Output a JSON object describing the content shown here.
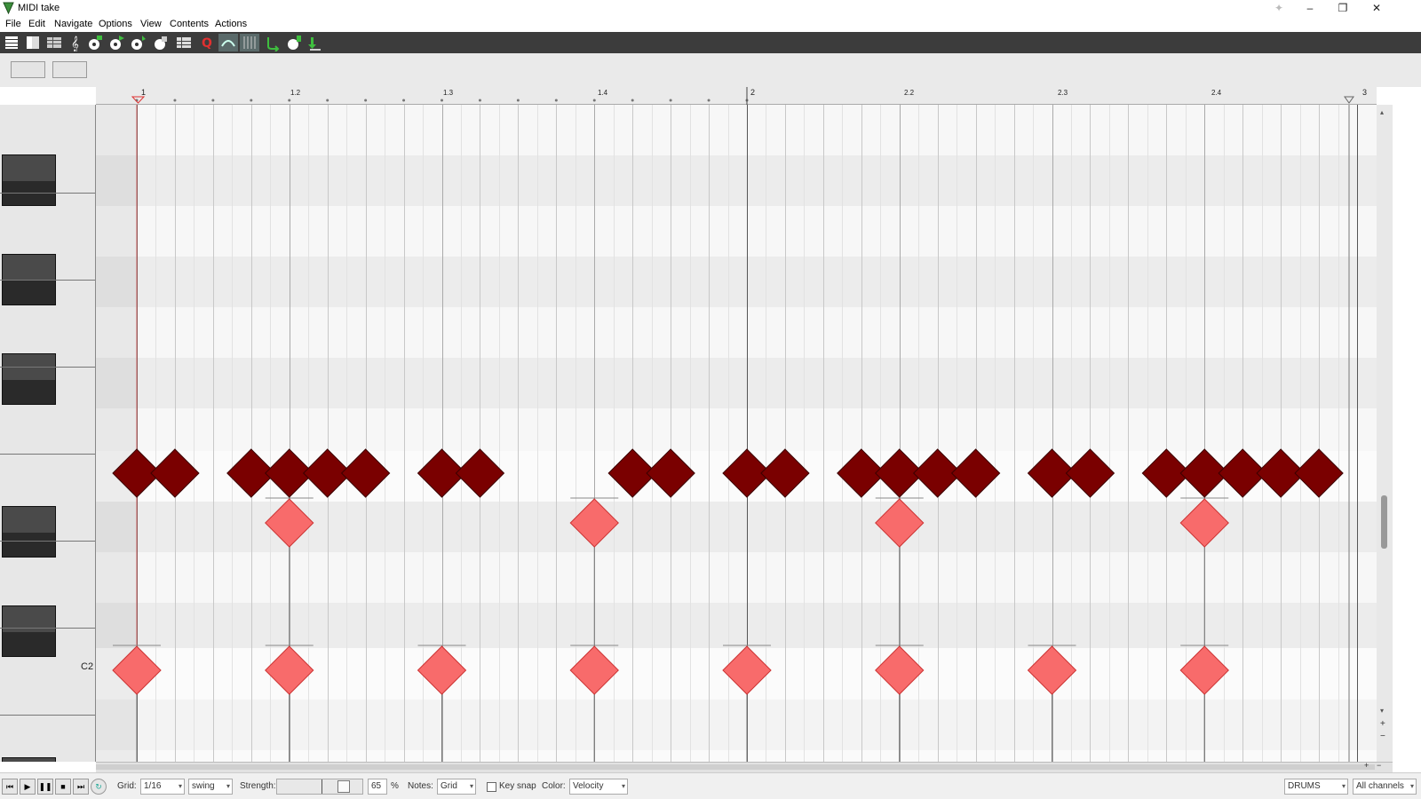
{
  "window": {
    "title": "MIDI take",
    "controls": {
      "minimize": "–",
      "restore": "❐",
      "close": "✕"
    },
    "pin_icon": "pin-icon"
  },
  "menu": [
    "File",
    "Edit",
    "Navigate",
    "Options",
    "View",
    "Contents",
    "Actions"
  ],
  "toolbar": {
    "buttons": [
      {
        "name": "piano-roll-mode-icon",
        "active": false
      },
      {
        "name": "named-notes-mode-icon",
        "active": false
      },
      {
        "name": "event-list-mode-icon",
        "active": false
      },
      {
        "name": "notation-mode-icon",
        "active": false
      },
      {
        "name": "midi-input-icon",
        "active": false
      },
      {
        "name": "step-input-icon",
        "active": false
      },
      {
        "name": "insert-note-icon",
        "active": false
      },
      {
        "name": "velocity-icon",
        "active": false
      },
      {
        "name": "drum-map-icon",
        "active": false
      },
      {
        "name": "grid-icon",
        "active": false
      },
      {
        "name": "quantize-icon",
        "active": false
      },
      {
        "name": "snap-icon",
        "active": true
      },
      {
        "name": "grid-lines-icon",
        "active": true
      },
      {
        "name": "loop-icon",
        "active": false
      },
      {
        "name": "preview-icon",
        "active": false
      },
      {
        "name": "export-icon",
        "active": false
      }
    ]
  },
  "ruler": {
    "labels": [
      "1",
      "1.2",
      "1.3",
      "1.4",
      "2",
      "2.2",
      "2.3",
      "2.4",
      "3"
    ]
  },
  "piano": {
    "c_label": "C2"
  },
  "notes": {
    "top_row_hits": [
      1.0,
      1.0625,
      1.1875,
      1.25,
      1.3125,
      1.375,
      1.5,
      1.5625,
      1.8125,
      1.875,
      2.0,
      2.0625,
      2.1875,
      2.25,
      2.3125,
      2.375,
      2.5,
      2.5625,
      2.6875,
      2.75,
      2.8125,
      2.875,
      2.9375
    ],
    "middle_row_hits": [
      1.25,
      1.75,
      2.25,
      2.75
    ],
    "bottom_row_hits": [
      1.0,
      1.25,
      1.5,
      1.75,
      2.0,
      2.25,
      2.5,
      2.75
    ],
    "colors": {
      "dark": "#7a0000",
      "light": "#f86b6b"
    }
  },
  "bottom": {
    "grid_label": "Grid:",
    "grid_value": "1/16",
    "swing_value": "swing",
    "strength_label": "Strength:",
    "strength_value": "65",
    "percent": "%",
    "notes_label": "Notes:",
    "notes_value": "Grid",
    "key_snap_label": "Key snap",
    "color_label": "Color:",
    "color_value": "Velocity",
    "drum_map": "DRUMS",
    "channels": "All channels"
  }
}
